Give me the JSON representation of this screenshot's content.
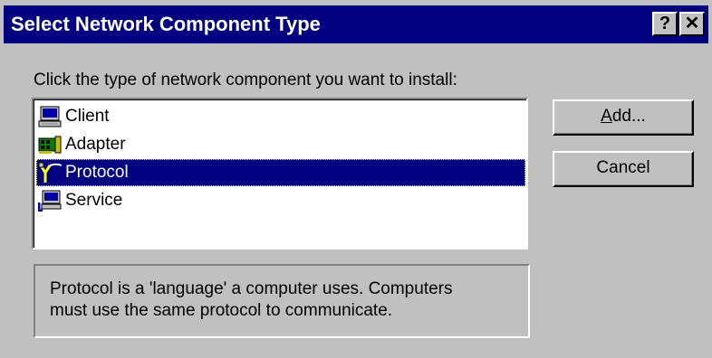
{
  "window": {
    "title": "Select Network Component Type",
    "help_button": "?",
    "close_button": "✕"
  },
  "instruction": "Click the type of network component you want to install:",
  "components": [
    {
      "label": "Client",
      "icon": "client-computer-icon",
      "selected": false
    },
    {
      "label": "Adapter",
      "icon": "network-adapter-icon",
      "selected": false
    },
    {
      "label": "Protocol",
      "icon": "protocol-cable-icon",
      "selected": true
    },
    {
      "label": "Service",
      "icon": "service-computer-icon",
      "selected": false
    }
  ],
  "buttons": {
    "add_mnemonic": "A",
    "add_rest": "dd...",
    "cancel": "Cancel"
  },
  "description": {
    "line1": "Protocol is a 'language' a computer uses. Computers",
    "line2": "must use the same protocol to communicate."
  },
  "colors": {
    "title_bar": "#000080",
    "face": "#c0c0c0",
    "selection": "#000080"
  }
}
